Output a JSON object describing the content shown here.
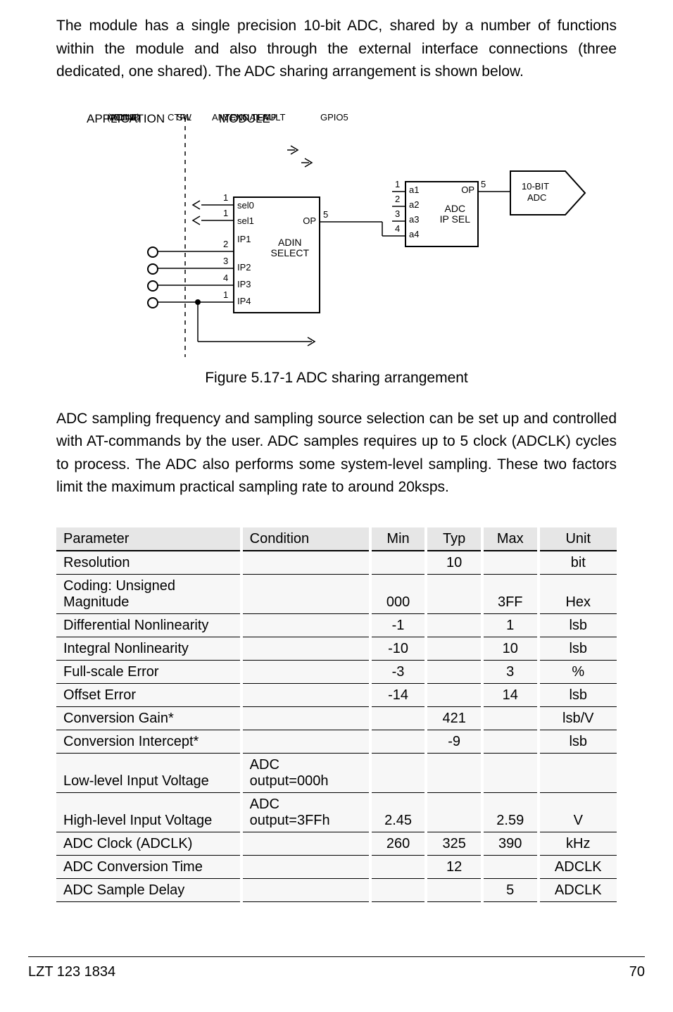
{
  "para1": "The module has a single precision 10-bit ADC, shared by a number of functions within the module and also through the external interface connections (three dedicated, one shared).  The ADC sharing arrangement is shown below.",
  "figcap": "Figure 5.17-1  ADC sharing arrangement",
  "para2": "ADC sampling frequency and sampling source selection can be set up and controlled with AT-commands by the user.  ADC samples requires up to 5 clock (ADCLK) cycles to process.  The ADC also performs some system-level sampling.  These two factors limit the maximum practical sampling rate to around 20ksps.",
  "footer": {
    "left": "LZT 123 1834",
    "right": "70"
  },
  "diagram": {
    "titles": {
      "application": "APPLICATION",
      "module": "MODULE"
    },
    "signals": {
      "vcxo": "VCXO TEMP",
      "antfault": "ANTENNA FAULT",
      "swctrl1": "SW",
      "swctrl2": "CTRL",
      "adin1": "ADIN1",
      "adin2": "ADIN2",
      "adin3": "ADIN3",
      "adin4": "(ADIN4)",
      "gpio5": "GPIO5"
    },
    "adin_select": {
      "name1": "ADIN",
      "name2": "SELECT",
      "pins": {
        "sel0": "sel0",
        "sel1": "sel1",
        "ip1": "IP1",
        "ip2": "IP2",
        "ip3": "IP3",
        "ip4": "IP4",
        "op": "OP"
      },
      "nums": {
        "sw1": "1",
        "sw2": "1",
        "adin1": "2",
        "adin2": "3",
        "adin3": "4",
        "adin4": "1",
        "op": "5"
      }
    },
    "adc_ip_sel": {
      "name1": "ADC",
      "name2": "IP SEL",
      "pins": {
        "a1": "a1",
        "a2": "a2",
        "a3": "a3",
        "a4": "a4",
        "op": "OP"
      },
      "nums": {
        "a1": "1",
        "a2": "2",
        "a3": "3",
        "a4": "4",
        "op": "5"
      }
    },
    "adc": {
      "name1": "10-BIT",
      "name2": "ADC"
    }
  },
  "chart_data": {
    "type": "table",
    "columns": [
      "Parameter",
      "Condition",
      "Min",
      "Typ",
      "Max",
      "Unit"
    ],
    "rows": [
      {
        "param": "Resolution",
        "cond": "",
        "min": "",
        "typ": "10",
        "max": "",
        "unit": "bit"
      },
      {
        "param": "Coding: Unsigned Magnitude",
        "cond": "",
        "min": "000",
        "typ": "",
        "max": "3FF",
        "unit": "Hex"
      },
      {
        "param": "Differential Nonlinearity",
        "cond": "",
        "min": "-1",
        "typ": "",
        "max": "1",
        "unit": "lsb"
      },
      {
        "param": "Integral Nonlinearity",
        "cond": "",
        "min": "-10",
        "typ": "",
        "max": "10",
        "unit": "lsb"
      },
      {
        "param": "Full-scale Error",
        "cond": "",
        "min": "-3",
        "typ": "",
        "max": "3",
        "unit": "%"
      },
      {
        "param": "Offset Error",
        "cond": "",
        "min": "-14",
        "typ": "",
        "max": "14",
        "unit": "lsb"
      },
      {
        "param": "Conversion Gain*",
        "cond": "",
        "min": "",
        "typ": "421",
        "max": "",
        "unit": "lsb/V"
      },
      {
        "param": "Conversion Intercept*",
        "cond": "",
        "min": "",
        "typ": "-9",
        "max": "",
        "unit": "lsb"
      },
      {
        "param": "Low-level Input Voltage",
        "cond": "ADC output=000h",
        "min": "",
        "typ": "",
        "max": "",
        "unit": ""
      },
      {
        "param": "High-level Input Voltage",
        "cond": "ADC output=3FFh",
        "min": "2.45",
        "typ": "",
        "max": "2.59",
        "unit": "V"
      },
      {
        "param": "ADC Clock (ADCLK)",
        "cond": "",
        "min": "260",
        "typ": "325",
        "max": "390",
        "unit": "kHz"
      },
      {
        "param": "ADC Conversion Time",
        "cond": "",
        "min": "",
        "typ": "12",
        "max": "",
        "unit": "ADCLK"
      },
      {
        "param": "ADC Sample Delay",
        "cond": "",
        "min": "",
        "typ": "",
        "max": "5",
        "unit": "ADCLK"
      }
    ]
  }
}
